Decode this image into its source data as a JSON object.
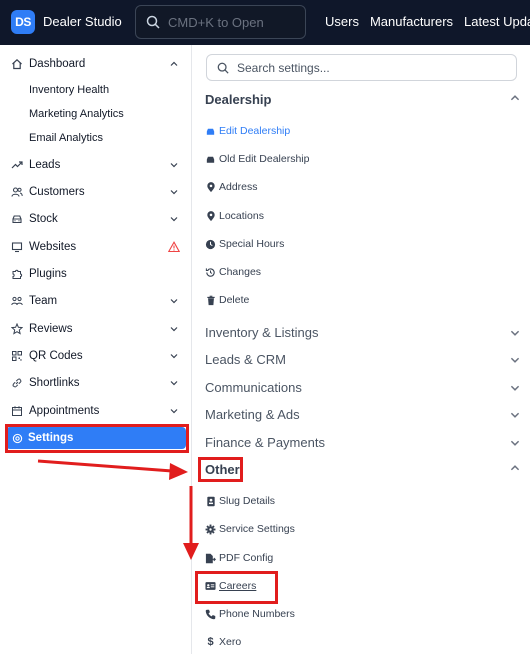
{
  "app": {
    "logo_text": "DS",
    "name": "Dealer Studio",
    "search_placeholder": "CMD+K to Open",
    "nav_links": [
      "Users",
      "Manufacturers",
      "Latest Update"
    ]
  },
  "sidebar": {
    "items": [
      {
        "label": "Dashboard",
        "icon": "home-icon",
        "chevron": "up"
      },
      {
        "label": "Inventory Health"
      },
      {
        "label": "Marketing Analytics"
      },
      {
        "label": "Email Analytics"
      },
      {
        "label": "Leads",
        "icon": "trend-icon",
        "chevron": "down"
      },
      {
        "label": "Customers",
        "icon": "users-icon",
        "chevron": "down"
      },
      {
        "label": "Stock",
        "icon": "car-icon",
        "chevron": "down"
      },
      {
        "label": "Websites",
        "icon": "monitor-icon",
        "badge": "warning-icon"
      },
      {
        "label": "Plugins",
        "icon": "puzzle-icon"
      },
      {
        "label": "Team",
        "icon": "team-icon",
        "chevron": "down"
      },
      {
        "label": "Reviews",
        "icon": "star-icon",
        "chevron": "down"
      },
      {
        "label": "QR Codes",
        "icon": "qr-icon",
        "chevron": "down"
      },
      {
        "label": "Shortlinks",
        "icon": "link-icon",
        "chevron": "down"
      },
      {
        "label": "Appointments",
        "icon": "calendar-icon",
        "chevron": "down"
      },
      {
        "label": "Settings",
        "icon": "gear-icon",
        "active": true
      }
    ]
  },
  "settings_panel": {
    "search_placeholder": "Search settings...",
    "dealership": {
      "title": "Dealership",
      "items": [
        "Edit Dealership",
        "Old Edit Dealership",
        "Address",
        "Locations",
        "Special Hours",
        "Changes",
        "Delete"
      ]
    },
    "collapsed_sections": [
      "Inventory & Listings",
      "Leads & CRM",
      "Communications",
      "Marketing & Ads",
      "Finance & Payments"
    ],
    "other": {
      "title": "Other",
      "items": [
        "Slug Details",
        "Service Settings",
        "PDF Config",
        "Careers",
        "Phone Numbers",
        "Xero"
      ]
    }
  },
  "annotation_color": "#e11d1d",
  "accent_color": "#2f7df6"
}
